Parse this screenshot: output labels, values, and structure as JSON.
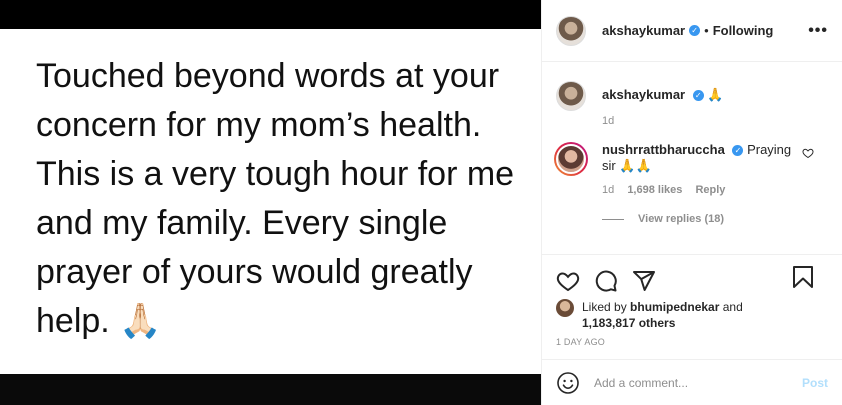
{
  "post": {
    "text": "Touched beyond words at your concern for my mom’s health. This is a very tough hour for me and my family. Every single prayer of yours would greatly help. 🙏🏻"
  },
  "header": {
    "username": "akshaykumar",
    "separator": "•",
    "follow_label": "Following",
    "more_label": "•••",
    "verified_icon": "verified-check-icon"
  },
  "caption": {
    "username": "akshaykumar",
    "text": "🙏",
    "time": "1d"
  },
  "comment": {
    "username": "nushrrattbharuccha",
    "text": "Praying sir 🙏🙏",
    "time": "1d",
    "likes": "1,698 likes",
    "reply_label": "Reply",
    "view_replies": "View replies (18)"
  },
  "actions": {
    "icons": [
      "heart-icon",
      "comment-icon",
      "share-icon",
      "bookmark-icon"
    ]
  },
  "likes": {
    "prefix": "Liked by",
    "user": "bhumipednekar",
    "middle": "and",
    "others": "1,183,817 others"
  },
  "timestamp": "1 DAY AGO",
  "add_comment": {
    "placeholder": "Add a comment...",
    "post_label": "Post"
  },
  "colors": {
    "verified": "#3897f0",
    "post_disabled": "#b2dffc",
    "muted": "#8e8e8e"
  }
}
